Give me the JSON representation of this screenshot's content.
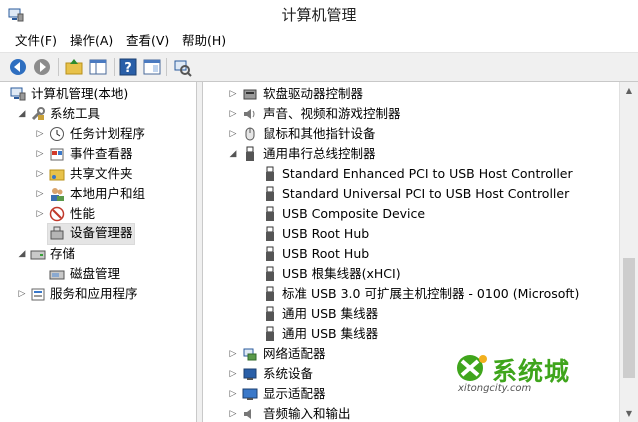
{
  "window": {
    "title": "计算机管理"
  },
  "menu": [
    "文件(F)",
    "操作(A)",
    "查看(V)",
    "帮助(H)"
  ],
  "toolbar": {
    "buttons": [
      "back-icon",
      "forward-icon",
      "up-folder-icon",
      "show-tree-icon",
      "help-icon",
      "properties-icon",
      "scan-hardware-icon"
    ]
  },
  "tree": {
    "root": "计算机管理(本地)",
    "system_tools": "系统工具",
    "task_scheduler": "任务计划程序",
    "event_viewer": "事件查看器",
    "shared_folders": "共享文件夹",
    "local_users": "本地用户和组",
    "performance": "性能",
    "device_manager": "设备管理器",
    "storage": "存储",
    "disk_management": "磁盘管理",
    "services_apps": "服务和应用程序"
  },
  "devices": {
    "floppy": "软盘驱动器控制器",
    "sound": "声音、视频和游戏控制器",
    "mice": "鼠标和其他指针设备",
    "usb": "通用串行总线控制器",
    "usb_children": [
      "Standard Enhanced PCI to USB Host Controller",
      "Standard Universal PCI to USB Host Controller",
      "USB Composite Device",
      "USB Root Hub",
      "USB Root Hub",
      "USB 根集线器(xHCI)",
      "标准 USB 3.0 可扩展主机控制器 - 0100 (Microsoft)",
      "通用 USB 集线器",
      "通用 USB 集线器"
    ],
    "network": "网络适配器",
    "system": "系统设备",
    "display": "显示适配器",
    "audio_io": "音频输入和输出"
  },
  "watermark": {
    "main": "系统城",
    "sub": "xitongcity.com"
  },
  "colors": {
    "watermark_green": "#3fa51c",
    "selection": "#e5e5e5",
    "toolbar_bg": "#f0f0f0"
  }
}
